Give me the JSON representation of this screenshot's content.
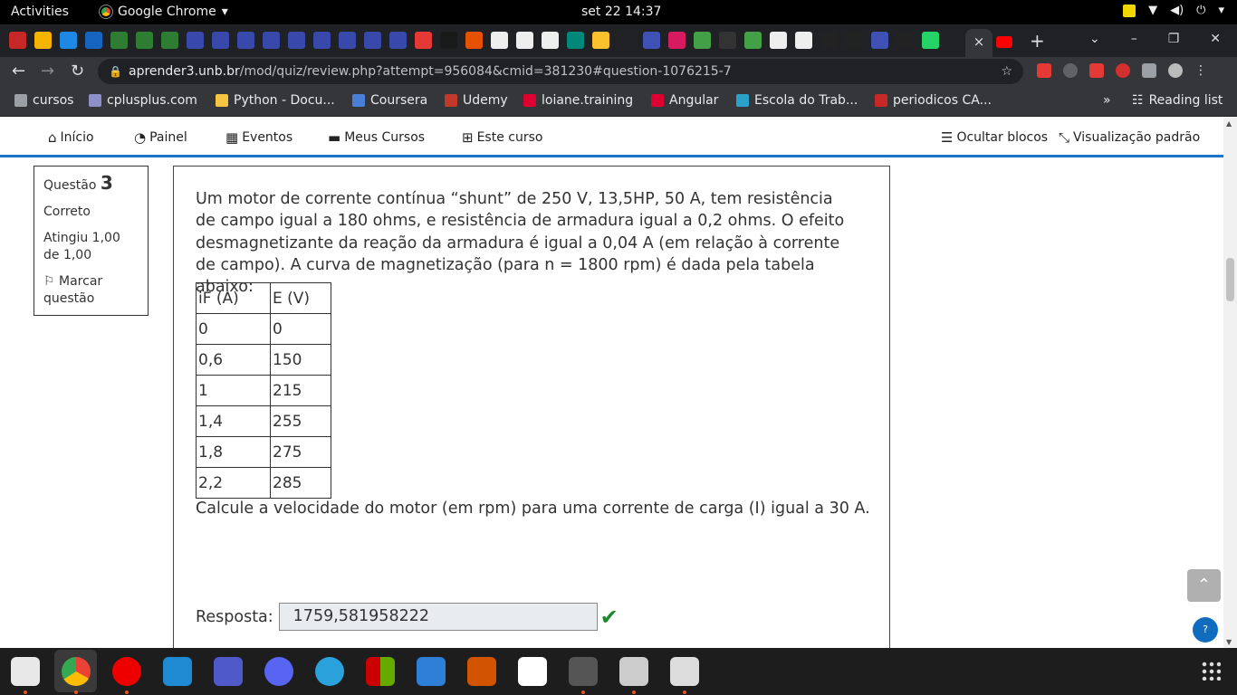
{
  "system": {
    "activities": "Activities",
    "app_name": "Google Chrome",
    "clock": "set 22  14:37"
  },
  "browser": {
    "url_host": "aprender3.unb.br",
    "url_path": "/mod/quiz/review.php?attempt=956084&cmid=381230#question-1076215-7",
    "new_tab": "+",
    "close_tab": "×"
  },
  "bookmarks": {
    "items": [
      "cursos",
      "cplusplus.com",
      "Python - Docu...",
      "Coursera",
      "Udemy",
      "loiane.training",
      "Angular",
      "Escola do Trab...",
      "periodicos CA..."
    ],
    "overflow": "»",
    "reading_list": "Reading list"
  },
  "nav": {
    "inicio": "Início",
    "painel": "Painel",
    "eventos": "Eventos",
    "meus_cursos": "Meus Cursos",
    "este_curso": "Este curso",
    "ocultar_blocos": "Ocultar blocos",
    "visualizacao": "Visualização padrão"
  },
  "question_info": {
    "label": "Questão",
    "number": "3",
    "state": "Correto",
    "grade": "Atingiu 1,00 de 1,00",
    "flag": "Marcar questão"
  },
  "question": {
    "text": "Um motor de corrente contínua “shunt” de 250 V, 13,5HP, 50 A, tem resistência de campo igual a 180 ohms, e resistência de armadura igual a 0,2 ohms. O efeito desmagnetizante da reação da armadura é igual a 0,04 A (em relação à corrente de campo). A curva de magnetização (para n = 1800 rpm) é dada pela tabela abaixo:",
    "table_headers": [
      "iF (A)",
      "E (V)"
    ],
    "table_rows": [
      [
        "0",
        "0"
      ],
      [
        "0,6",
        "150"
      ],
      [
        "1",
        "215"
      ],
      [
        "1,4",
        "255"
      ],
      [
        "1,8",
        "275"
      ],
      [
        "2,2",
        "285"
      ]
    ],
    "prompt": "Calcule a velocidade do motor (em rpm) para uma corrente de carga (I) igual a 30 A.",
    "answer_label": "Resposta:",
    "answer_value": "1759,581958222"
  },
  "help": "?"
}
